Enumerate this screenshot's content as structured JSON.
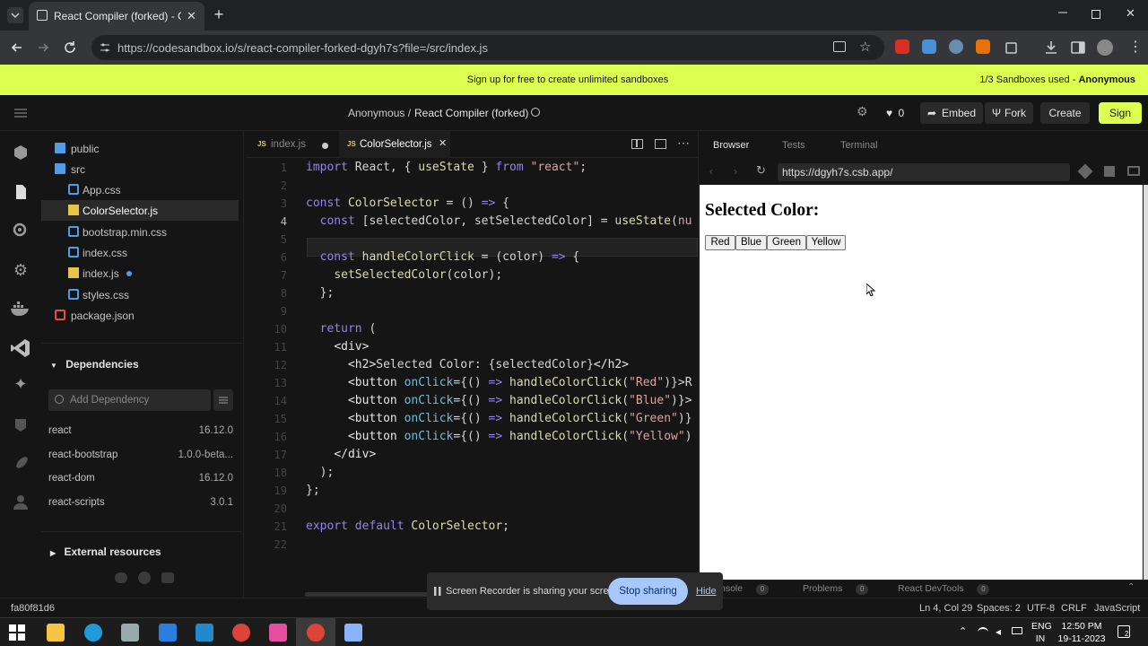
{
  "browser": {
    "tab_title": "React Compiler (forked) - CodeSandbox",
    "url": "https://codesandbox.io/s/react-compiler-forked-dgyh7s?file=/src/index.js"
  },
  "banner": {
    "message": "Sign up for free to create unlimited sandboxes",
    "usage_prefix": "1/3 Sandboxes used - ",
    "usage_user": "Anonymous"
  },
  "header": {
    "owner": "Anonymous /",
    "sandbox_name": "React Compiler (forked)",
    "likes": "0",
    "embed": "Embed",
    "fork": "Fork",
    "create": "Create",
    "signin": "Sign in"
  },
  "explorer": {
    "tree": [
      {
        "name": "public",
        "type": "folder"
      },
      {
        "name": "src",
        "type": "folder-open"
      },
      {
        "name": "App.css",
        "type": "css"
      },
      {
        "name": "ColorSelector.js",
        "type": "js"
      },
      {
        "name": "bootstrap.min.css",
        "type": "css"
      },
      {
        "name": "index.css",
        "type": "css"
      },
      {
        "name": "index.js",
        "type": "js"
      },
      {
        "name": "styles.css",
        "type": "css"
      },
      {
        "name": "package.json",
        "type": "json"
      }
    ],
    "dependencies_title": "Dependencies",
    "add_dependency_placeholder": "Add Dependency",
    "dependencies": [
      {
        "name": "react",
        "version": "16.12.0"
      },
      {
        "name": "react-bootstrap",
        "version": "1.0.0-beta..."
      },
      {
        "name": "react-dom",
        "version": "16.12.0"
      },
      {
        "name": "react-scripts",
        "version": "3.0.1"
      }
    ],
    "external_resources": "External resources"
  },
  "editor": {
    "tabs": [
      {
        "name": "index.js",
        "active": false
      },
      {
        "name": "ColorSelector.js",
        "active": true
      }
    ],
    "line_numbers": [
      "1",
      "2",
      "3",
      "4",
      "5",
      "6",
      "7",
      "8",
      "9",
      "10",
      "11",
      "12",
      "13",
      "14",
      "15",
      "16",
      "17",
      "18",
      "19",
      "20",
      "21",
      "22"
    ],
    "current_line": "4"
  },
  "preview": {
    "tabs": [
      "Browser",
      "Tests",
      "Terminal"
    ],
    "url": "https://dgyh7s.csb.app/",
    "heading": "Selected Color:",
    "buttons": [
      "Red",
      "Blue",
      "Green",
      "Yellow"
    ],
    "console_tabs": [
      {
        "label": "nsole",
        "count": "0"
      },
      {
        "label": "Problems",
        "count": "0"
      },
      {
        "label": "React DevTools",
        "count": "0"
      }
    ]
  },
  "statusbar": {
    "commit": "fa80f81d6",
    "position": "Ln 4, Col 29",
    "spaces": "Spaces: 2",
    "encoding": "UTF-8",
    "eol": "CRLF",
    "language": "JavaScript"
  },
  "screen_share": {
    "message": "Screen Recorder is sharing your screen.",
    "stop": "Stop sharing",
    "hide": "Hide"
  },
  "taskbar": {
    "lang1": "ENG",
    "lang2": "IN",
    "time": "12:50 PM",
    "date": "19-11-2023",
    "notifications": "2"
  },
  "colors": {
    "accent": "#dcff50",
    "editor_bg": "#151515"
  }
}
